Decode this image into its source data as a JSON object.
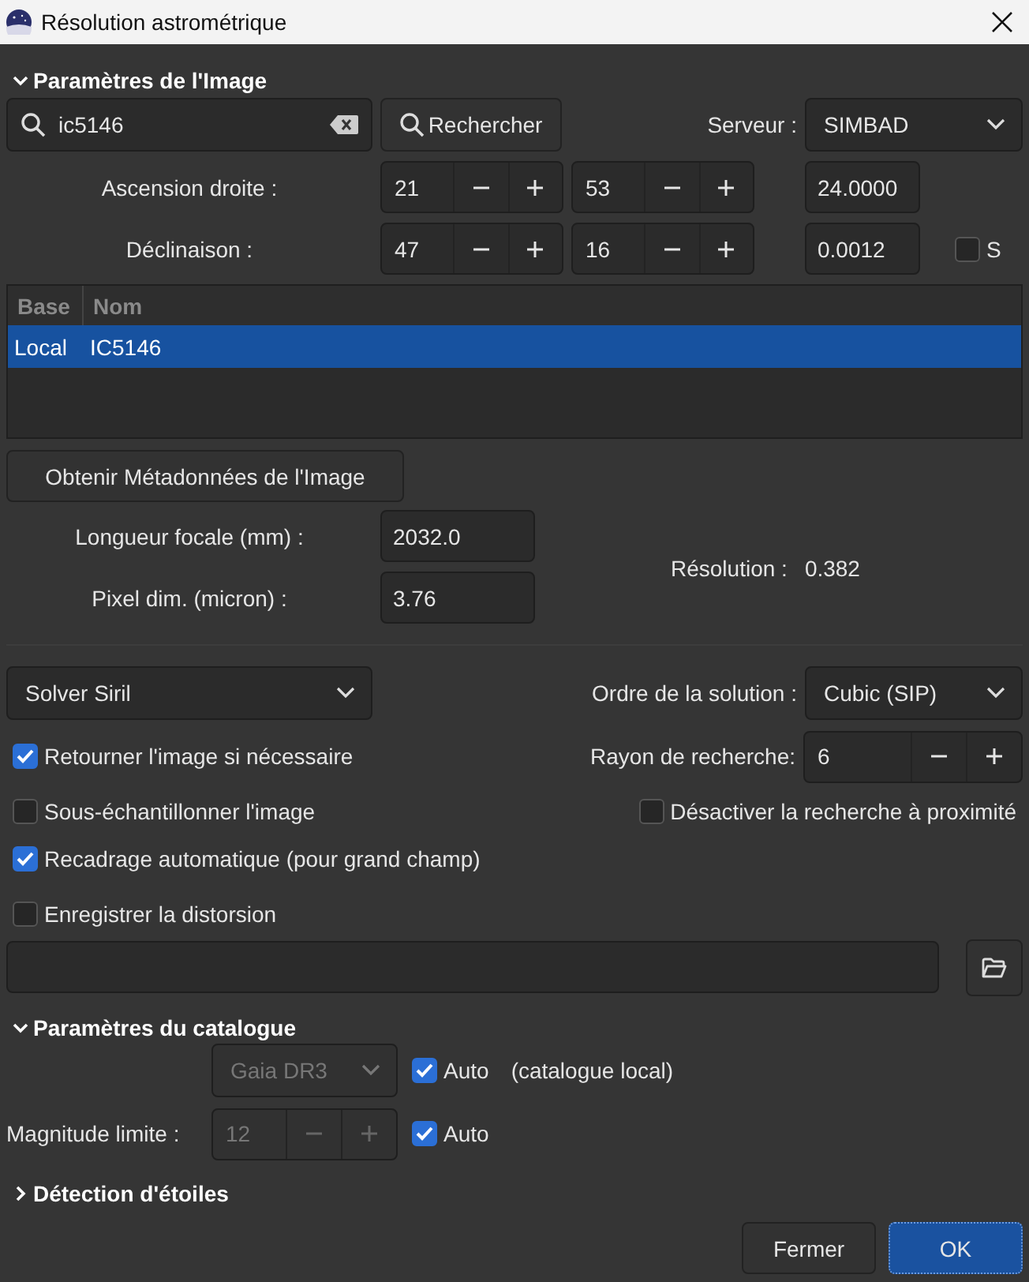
{
  "window": {
    "title": "Résolution astrométrique"
  },
  "image_section": {
    "title": "Paramètres de l'Image",
    "expanded": true,
    "search": {
      "value": "ic5146"
    },
    "search_button": "Rechercher",
    "server": {
      "label": "Serveur :",
      "value": "SIMBAD"
    },
    "ra": {
      "label": "Ascension droite :",
      "hours": "21",
      "minutes": "53",
      "seconds": "24.0000"
    },
    "dec": {
      "label": "Déclinaison :",
      "degrees": "47",
      "minutes": "16",
      "seconds": "0.0012",
      "south": {
        "label": "S",
        "checked": false
      }
    },
    "table": {
      "columns": [
        "Base",
        "Nom"
      ],
      "rows": [
        {
          "base": "Local",
          "nom": "IC5146",
          "selected": true
        }
      ]
    },
    "metadata_button": "Obtenir Métadonnées de l'Image",
    "focal": {
      "label": "Longueur focale (mm) :",
      "value": "2032.0"
    },
    "pixel": {
      "label": "Pixel dim. (micron) :",
      "value": "3.76"
    },
    "resolution": {
      "label": "Résolution :",
      "value": "0.382"
    }
  },
  "solver": {
    "value": "Solver Siril"
  },
  "order": {
    "label": "Ordre de la solution :",
    "value": "Cubic (SIP)"
  },
  "flip": {
    "label": "Retourner l'image si nécessaire",
    "checked": true
  },
  "radius": {
    "label": "Rayon de recherche:",
    "value": "6"
  },
  "downsample": {
    "label": "Sous-échantillonner l'image",
    "checked": false
  },
  "disable_nearby": {
    "label": "Désactiver la recherche à proximité",
    "checked": false
  },
  "autocrop": {
    "label": "Recadrage automatique (pour grand champ)",
    "checked": true
  },
  "save_distortion": {
    "label": "Enregistrer la distorsion",
    "checked": false
  },
  "catalogue_section": {
    "title": "Paramètres du catalogue",
    "expanded": true,
    "catalogue": {
      "value": "Gaia DR3",
      "disabled": true
    },
    "catalogue_auto": {
      "label": "Auto",
      "checked": true
    },
    "note": "(catalogue local)",
    "magnitude": {
      "label": "Magnitude limite :",
      "value": "12",
      "disabled": true
    },
    "magnitude_auto": {
      "label": "Auto",
      "checked": true
    }
  },
  "star_section": {
    "title": "Détection d'étoiles",
    "expanded": false
  },
  "buttons": [
    {
      "label": "Fermer",
      "kind": "normal"
    },
    {
      "label": "OK",
      "kind": "primary"
    }
  ]
}
